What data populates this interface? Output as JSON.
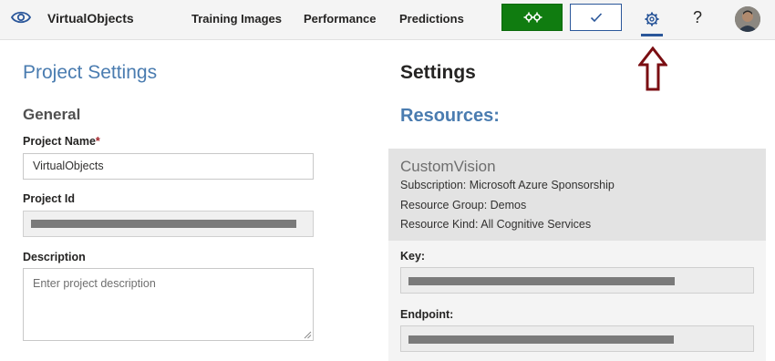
{
  "app": {
    "title": "VirtualObjects"
  },
  "nav": {
    "items": [
      {
        "label": "Training Images"
      },
      {
        "label": "Performance"
      },
      {
        "label": "Predictions"
      }
    ]
  },
  "toolbar": {
    "train_icon": "gears-icon",
    "quick_test_icon": "checkmark-icon",
    "settings_icon": "gear-icon",
    "help_label": "?"
  },
  "project_settings": {
    "title": "Project Settings",
    "section": "General",
    "name_label": "Project Name",
    "name_required_mark": "*",
    "name_value": "VirtualObjects",
    "id_label": "Project Id",
    "description_label": "Description",
    "description_placeholder": "Enter project description"
  },
  "settings": {
    "title": "Settings",
    "resources_heading": "Resources:",
    "resource": {
      "name": "CustomVision",
      "subscription": "Subscription:  Microsoft Azure Sponsorship",
      "resource_group": "Resource Group:  Demos",
      "resource_kind": "Resource Kind:  All Cognitive Services"
    },
    "key_label": "Key:",
    "endpoint_label": "Endpoint:"
  },
  "colors": {
    "accent": "#2b579a",
    "heading_blue": "#4a7cb0",
    "train_green": "#107c10",
    "annotation_arrow": "#7a0e12"
  }
}
